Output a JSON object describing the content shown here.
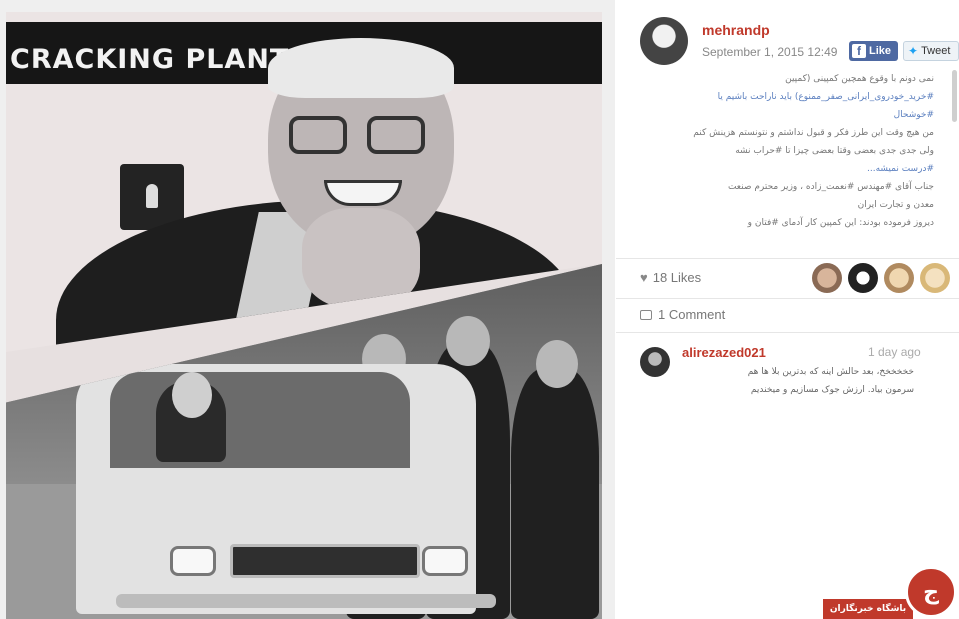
{
  "photo": {
    "sign_text": "CRACKING PLANT",
    "description_icon": "keyhole-icon"
  },
  "post": {
    "username": "mehrandp",
    "date": "September 1, 2015 12:49",
    "like_label": "Like",
    "tweet_label": "Tweet",
    "caption_lines": [
      "نمی دونم با وقوع همچین کمپینی (کمپین",
      "#خرید_خودروی_ایرانی_صفر_ممنوع) باید ناراحت باشیم یا",
      "#خوشحال",
      "من هیچ وقت این طرز فکر و قبول نداشتم و نتونستم هزینش کنم",
      "ولی جدی جدی بعضی وقتا بعضی چیزا تا #حراب نشه",
      "#درست نمیشه...",
      "جناب آقای #مهندس #نعمت_زاده ، وزیر محترم صنعت",
      "معدن و تجارت ایران",
      "دیروز فرموده بودند: این کمپین کار آدمای #فتان و"
    ],
    "likes": "18 Likes",
    "comments": "1 Comment",
    "comment": {
      "user": "alirezazed021",
      "time": "1 day ago",
      "lines": [
        "خخخخخخ، بعد حالش اینه که بدترین بلا ها هم",
        "سرمون بیاد. ارزش جوک مسازیم و میخندیم"
      ]
    }
  },
  "watermark": {
    "brand": "باشگاه خبرنگاران",
    "mark": "ج"
  },
  "colors": {
    "username": "#c0392b",
    "facebook": "#4e69a2",
    "hashtag": "#5b7fbf",
    "watermark": "#c0392b"
  }
}
